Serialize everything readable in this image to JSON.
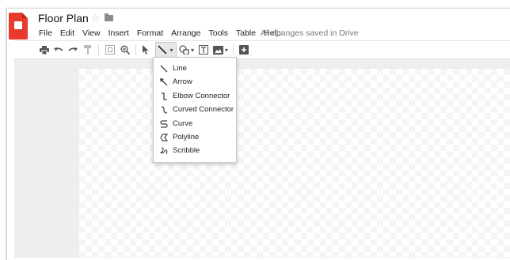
{
  "document": {
    "title": "Floor Plan",
    "save_status": "All changes saved in Drive"
  },
  "menubar": {
    "items": [
      "File",
      "Edit",
      "View",
      "Insert",
      "Format",
      "Arrange",
      "Tools",
      "Table",
      "Help"
    ]
  },
  "toolbar": {
    "tools": [
      "print-icon",
      "undo-icon",
      "redo-icon",
      "paint-format-icon",
      "zoom-fit-icon",
      "zoom-icon",
      "select-icon",
      "line-icon",
      "shape-icon",
      "text-box-icon",
      "image-icon",
      "add-comment-icon"
    ],
    "active_tool": "line-icon"
  },
  "line_menu": {
    "items": [
      {
        "label": "Line",
        "icon": "line-icon"
      },
      {
        "label": "Arrow",
        "icon": "arrow-icon"
      },
      {
        "label": "Elbow Connector",
        "icon": "elbow-connector-icon"
      },
      {
        "label": "Curved Connector",
        "icon": "curved-connector-icon"
      },
      {
        "label": "Curve",
        "icon": "curve-icon"
      },
      {
        "label": "Polyline",
        "icon": "polyline-icon"
      },
      {
        "label": "Scribble",
        "icon": "scribble-icon"
      }
    ]
  },
  "colors": {
    "brand": "#e83b2e",
    "canvas_bg": "#eeeeee",
    "menu_border": "#c9c9c9"
  }
}
